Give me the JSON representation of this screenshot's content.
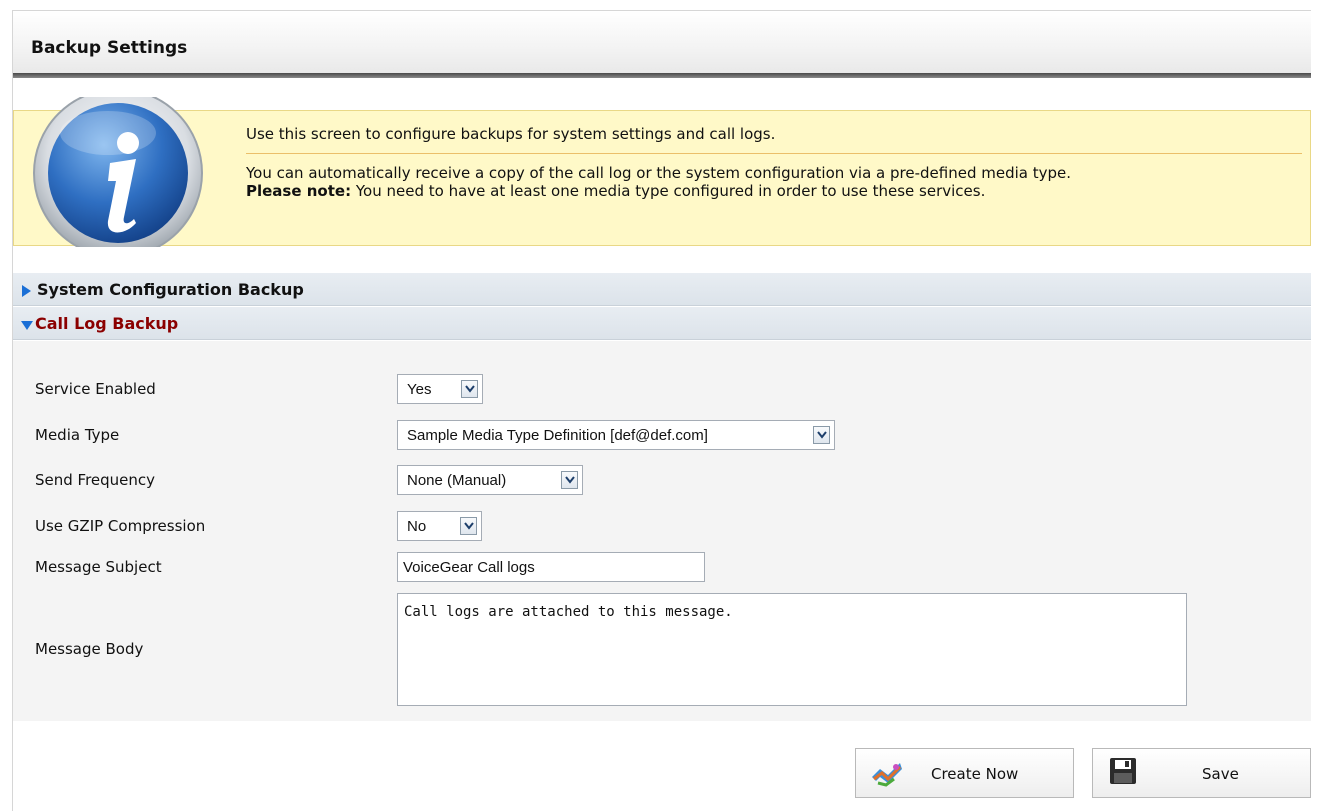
{
  "header": {
    "title": "Backup Settings"
  },
  "info": {
    "line1": "Use this screen to configure backups for system settings and call logs.",
    "line2": "You can automatically receive a copy of the call log or the system configuration via a pre-defined media type.",
    "note_label": "Please note:",
    "note_text": " You need to have at least one media type configured in order to use these services."
  },
  "sections": {
    "system_backup": "System Configuration Backup",
    "call_log_backup": "Call Log Backup"
  },
  "form": {
    "service_enabled": {
      "label": "Service Enabled",
      "value": "Yes"
    },
    "media_type": {
      "label": "Media Type",
      "value": "Sample Media Type Definition [def@def.com]"
    },
    "send_frequency": {
      "label": "Send Frequency",
      "value": "None (Manual)"
    },
    "gzip": {
      "label": "Use GZIP Compression",
      "value": "No"
    },
    "subject": {
      "label": "Message Subject",
      "value": "VoiceGear Call logs"
    },
    "body": {
      "label": "Message Body",
      "value": "Call logs are attached to this message."
    }
  },
  "actions": {
    "create_now": "Create Now",
    "save": "Save"
  },
  "colors": {
    "info_bg": "#fff9c8",
    "expanded_section": "#8b0000",
    "arrow": "#1a6fd6"
  },
  "icons": [
    "info-icon",
    "expand-arrow-icon",
    "collapse-arrow-icon",
    "dropdown-arrow-icon",
    "create-backup-icon",
    "floppy-disk-icon"
  ]
}
